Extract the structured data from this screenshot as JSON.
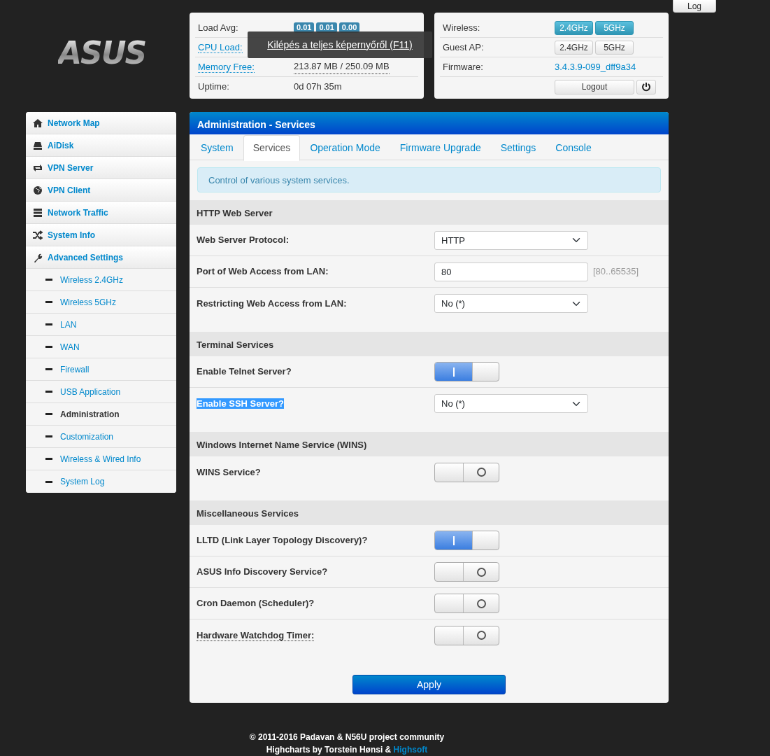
{
  "logo": {
    "text": "ASUS"
  },
  "log_button": "Log",
  "status": {
    "rows": [
      {
        "label": "Load Avg:",
        "link": false,
        "kind": "badges",
        "values": [
          "0.01",
          "0.01",
          "0.00"
        ]
      },
      {
        "label": "CPU Load:",
        "link": true,
        "kind": "hidden"
      },
      {
        "label": "Memory Free:",
        "link": true,
        "kind": "text",
        "value": "213.87 MB / 250.09 MB",
        "dotted": true
      },
      {
        "label": "Uptime:",
        "link": false,
        "kind": "text",
        "value": "0d 07h 35m",
        "dotted": false
      }
    ]
  },
  "network": {
    "rows": [
      {
        "label": "Wireless:",
        "kind": "buttons",
        "buttons": [
          {
            "label": "2.4GHz",
            "on": true
          },
          {
            "label": "5GHz",
            "on": true
          }
        ]
      },
      {
        "label": "Guest AP:",
        "kind": "buttons",
        "buttons": [
          {
            "label": "2.4GHz",
            "on": false
          },
          {
            "label": "5GHz",
            "on": false
          }
        ]
      },
      {
        "label": "Firmware:",
        "kind": "link",
        "value": "3.4.3.9-099_dff9a34"
      }
    ],
    "logout": "Logout"
  },
  "fullscreen_toast": "Kilépés a teljes képernyőről (F11)",
  "sidebar": {
    "items": [
      {
        "label": "Network Map"
      },
      {
        "label": "AiDisk"
      },
      {
        "label": "VPN Server"
      },
      {
        "label": "VPN Client"
      },
      {
        "label": "Network Traffic"
      },
      {
        "label": "System Info"
      },
      {
        "label": "Advanced Settings",
        "children": [
          {
            "label": "Wireless 2.4GHz",
            "selected": false
          },
          {
            "label": "Wireless 5GHz",
            "selected": false
          },
          {
            "label": "LAN",
            "selected": false
          },
          {
            "label": "WAN",
            "selected": false
          },
          {
            "label": "Firewall",
            "selected": false
          },
          {
            "label": "USB Application",
            "selected": false
          },
          {
            "label": "Administration",
            "selected": true
          },
          {
            "label": "Customization",
            "selected": false
          },
          {
            "label": "Wireless & Wired Info",
            "selected": false
          },
          {
            "label": "System Log",
            "selected": false
          }
        ]
      }
    ]
  },
  "panel": {
    "title": "Administration - Services",
    "tabs": [
      {
        "label": "System",
        "selected": false
      },
      {
        "label": "Services",
        "selected": true
      },
      {
        "label": "Operation Mode",
        "selected": false
      },
      {
        "label": "Firmware Upgrade",
        "selected": false
      },
      {
        "label": "Settings",
        "selected": false
      },
      {
        "label": "Console",
        "selected": false
      }
    ],
    "info": "Control of various system services.",
    "sections": [
      {
        "title": "HTTP Web Server",
        "rows": [
          {
            "label": "Web Server Protocol:",
            "kind": "select",
            "value": "HTTP"
          },
          {
            "label": "Port of Web Access from LAN:",
            "kind": "input",
            "value": "80",
            "hint": "[80..65535]"
          },
          {
            "label": "Restricting Web Access from LAN:",
            "kind": "select",
            "value": "No (*)"
          }
        ]
      },
      {
        "title": "Terminal Services",
        "rows": [
          {
            "label": "Enable Telnet Server?",
            "kind": "toggle",
            "on": true
          },
          {
            "label": "Enable SSH Server?",
            "kind": "select",
            "value": "No (*)",
            "highlighted": true
          }
        ]
      },
      {
        "title": "Windows Internet Name Service (WINS)",
        "rows": [
          {
            "label": "WINS Service?",
            "kind": "toggle",
            "on": false
          }
        ]
      },
      {
        "title": "Miscellaneous Services",
        "rows": [
          {
            "label": "LLTD (Link Layer Topology Discovery)?",
            "kind": "toggle",
            "on": true
          },
          {
            "label": "ASUS Info Discovery Service?",
            "kind": "toggle",
            "on": false
          },
          {
            "label": "Cron Daemon (Scheduler)?",
            "kind": "toggle",
            "on": false
          },
          {
            "label": "Hardware Watchdog Timer:",
            "kind": "toggle",
            "on": false,
            "dotted": true
          }
        ]
      }
    ],
    "apply": "Apply"
  },
  "footer": {
    "copyright": "© 2011-2016 Padavan & N56U project community",
    "credit": "Highcharts by Torstein Hønsi & ",
    "credit_link": "Highsoft"
  }
}
